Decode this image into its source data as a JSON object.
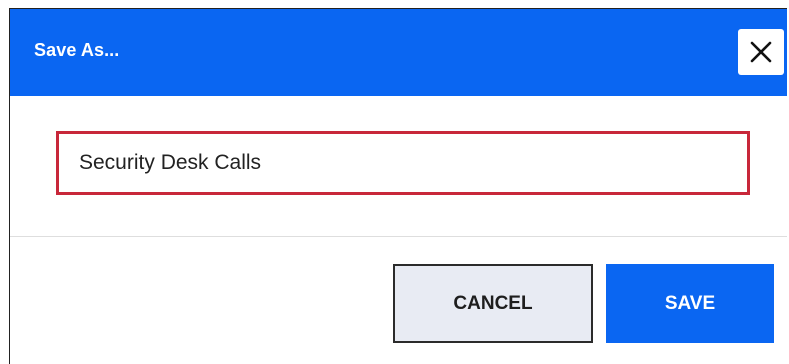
{
  "dialog": {
    "title": "Save As...",
    "close_icon": "close-icon"
  },
  "form": {
    "name_value": "Security Desk Calls"
  },
  "actions": {
    "cancel_label": "CANCEL",
    "save_label": "SAVE"
  },
  "colors": {
    "accent": "#0a66f2",
    "input_border": "#c8273a",
    "cancel_bg": "#e8ebf3"
  }
}
